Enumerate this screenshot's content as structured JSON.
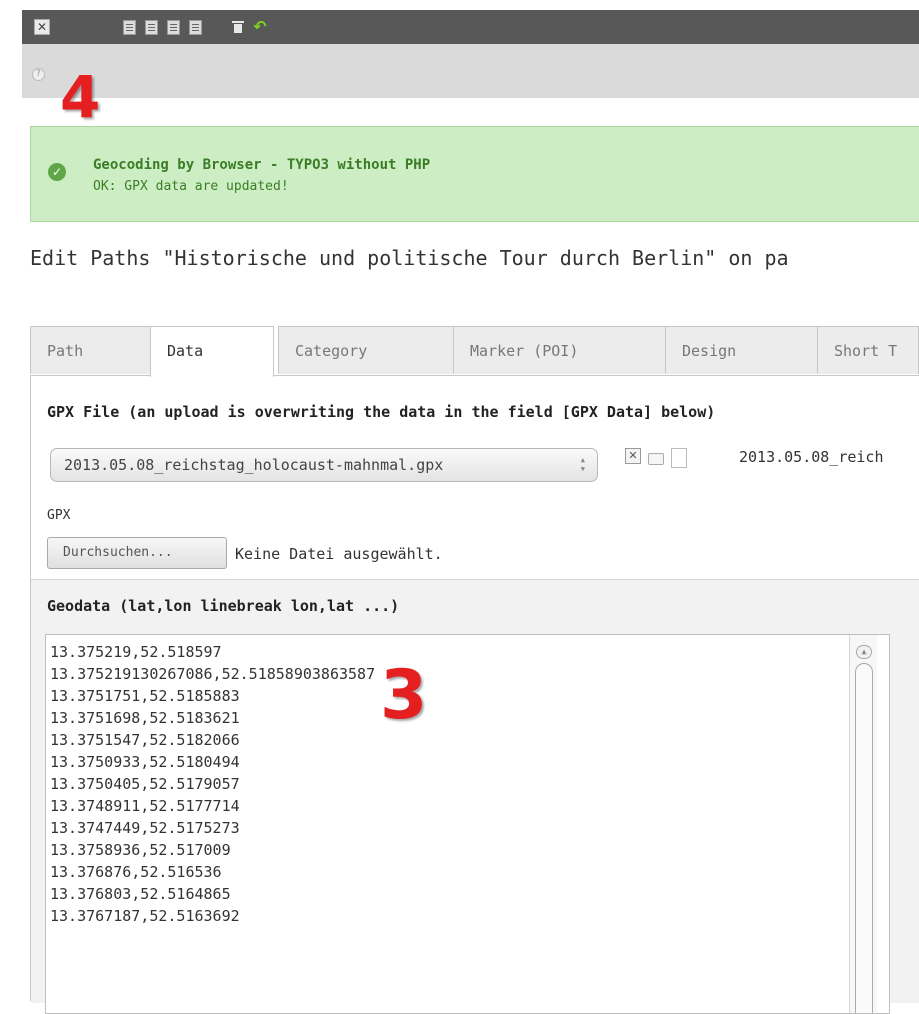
{
  "toolbar": {
    "close_icon": "close-icon",
    "buttons": [
      "save-icon",
      "save-view-icon",
      "save-close-icon",
      "save-new-icon",
      "delete-icon",
      "undo-icon"
    ]
  },
  "annotations": {
    "a4": "4",
    "a3": "3"
  },
  "flash": {
    "title": "Geocoding by Browser - TYPO3 without PHP",
    "message": "OK: GPX data are updated!",
    "color": "#3a7d26"
  },
  "page": {
    "title": "Edit Paths \"Historische und politische Tour durch Berlin\" on pa"
  },
  "tabs": [
    {
      "label": "Path"
    },
    {
      "label": "Data"
    },
    {
      "label": "Category"
    },
    {
      "label": "Marker (POI)"
    },
    {
      "label": "Design"
    },
    {
      "label": "Short T"
    }
  ],
  "gpx_file": {
    "label": "GPX File (an upload is overwriting the data in the field [GPX Data] below)",
    "selected": "2013.05.08_reichstag_holocaust-mahnmal.gpx",
    "file_name": "2013.05.08_reich"
  },
  "upload": {
    "label": "GPX",
    "button": "Durchsuchen...",
    "status": "Keine Datei ausgewählt."
  },
  "geodata": {
    "label": "Geodata (lat,lon linebreak lon,lat ...)",
    "lines": [
      "13.375219,52.518597",
      "13.375219130267086,52.51858903863587",
      "13.3751751,52.5185883",
      "13.3751698,52.5183621",
      "13.3751547,52.5182066",
      "13.3750933,52.5180494",
      "13.3750405,52.5179057",
      "13.3748911,52.5177714",
      "13.3747449,52.5175273",
      "13.3758936,52.517009",
      "13.376876,52.516536",
      "13.376803,52.5164865",
      "13.3767187,52.5163692"
    ]
  }
}
